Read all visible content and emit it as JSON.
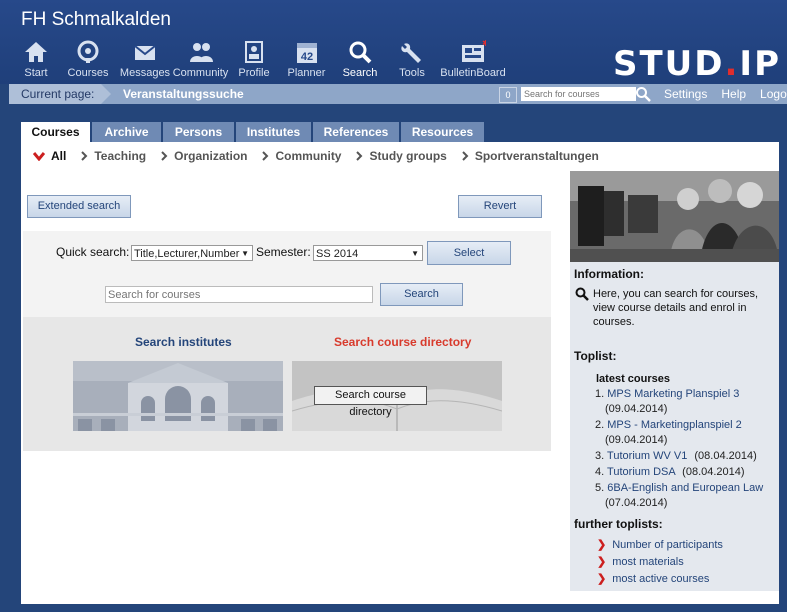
{
  "header": {
    "site_title": "FH Schmalkalden",
    "logo_text": "STUD",
    "logo_dot": ".",
    "logo_suffix": "IP",
    "nav": [
      {
        "label": "Start",
        "icon": "home-icon"
      },
      {
        "label": "Courses",
        "icon": "courses-icon"
      },
      {
        "label": "Messages",
        "icon": "envelope-icon"
      },
      {
        "label": "Community",
        "icon": "people-icon"
      },
      {
        "label": "Profile",
        "icon": "profile-icon"
      },
      {
        "label": "Planner",
        "icon": "calendar-icon"
      },
      {
        "label": "Search",
        "icon": "search-icon"
      },
      {
        "label": "Tools",
        "icon": "wrench-icon"
      },
      {
        "label": "BulletinBoard",
        "icon": "bulletinboard-icon"
      }
    ],
    "active_nav": "Search"
  },
  "statusbar": {
    "current_page_label": "Current page:",
    "current_page_value": "Veranstaltungssuche",
    "counter": "0",
    "search_placeholder": "Search for courses",
    "links": [
      "Settings",
      "Help",
      "Logout"
    ]
  },
  "tabs": [
    "Courses",
    "Archive",
    "Persons",
    "Institutes",
    "References",
    "Resources"
  ],
  "active_tab": "Courses",
  "subnav": [
    "All",
    "Teaching",
    "Organization",
    "Community",
    "Study groups",
    "Sportveranstaltungen"
  ],
  "main": {
    "extended_search_label": "Extended search",
    "revert_label": "Revert",
    "quick_search_label": "Quick search:",
    "quick_search_value": "Title,Lecturer,Number",
    "semester_label": "Semester:",
    "semester_value": "SS 2014",
    "select_label": "Select",
    "search_placeholder": "Search for courses",
    "search_button": "Search",
    "search_institutes_title": "Search institutes",
    "search_directory_title": "Search course directory",
    "search_directory_button": "Search course directory"
  },
  "sidebar": {
    "information_heading": "Information:",
    "information_text": "Here, you can search for courses, view course details and enrol in courses.",
    "toplist_heading": "Toplist:",
    "latest_heading": "latest courses",
    "latest_courses": [
      {
        "num": "1.",
        "title": "MPS Marketing Planspiel 3",
        "date": "(09.04.2014)"
      },
      {
        "num": "2.",
        "title": "MPS - Marketingplanspiel 2",
        "date": "(09.04.2014)"
      },
      {
        "num": "3.",
        "title": "Tutorium WV V1",
        "date": "(08.04.2014)"
      },
      {
        "num": "4.",
        "title": "Tutorium DSA",
        "date": "(08.04.2014)"
      },
      {
        "num": "5.",
        "title": "6BA-English and European Law",
        "date": "(07.04.2014)"
      }
    ],
    "further_heading": "further toplists:",
    "further_toplists": [
      "Number of participants",
      "most materials",
      "most active courses"
    ]
  },
  "colors": {
    "header_bg": "#24457a",
    "tab_bg": "#6f8ab4",
    "accent_red": "#e02d2d",
    "link": "#24457a"
  }
}
